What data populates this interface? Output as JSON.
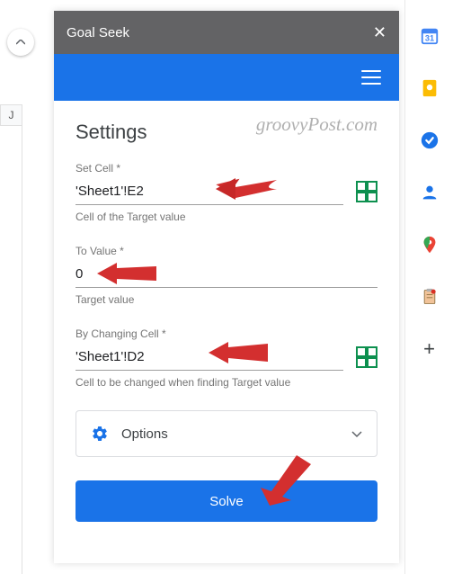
{
  "column_header": "J",
  "panel": {
    "title": "Goal Seek",
    "section_title": "Settings",
    "set_cell": {
      "label": "Set Cell *",
      "value": "'Sheet1'!E2",
      "helper": "Cell of the Target value"
    },
    "to_value": {
      "label": "To Value *",
      "value": "0",
      "helper": "Target value"
    },
    "by_changing": {
      "label": "By Changing Cell *",
      "value": "'Sheet1'!D2",
      "helper": "Cell to be changed when finding Target value"
    },
    "options_label": "Options",
    "solve_label": "Solve"
  },
  "watermark": "groovyPost.com"
}
